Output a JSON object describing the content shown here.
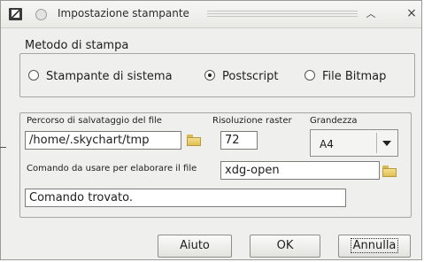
{
  "window": {
    "title": "Impostazione stampante"
  },
  "print_method": {
    "title": "Metodo di stampa",
    "options": [
      {
        "label": "Stampante di sistema",
        "selected": false
      },
      {
        "label": "Postscript",
        "selected": true
      },
      {
        "label": "File Bitmap",
        "selected": false
      }
    ]
  },
  "settings": {
    "save_path_label": "Percorso di salvataggio del file",
    "save_path_value": "/home/.skychart/tmp",
    "raster_label": "Risoluzione raster",
    "raster_value": "72",
    "size_label": "Grandezza",
    "size_value": "A4",
    "command_label": "Comando da usare per elaborare il file",
    "command_value": "xdg-open",
    "status_value": "Comando trovato."
  },
  "buttons": {
    "help": "Aiuto",
    "ok": "OK",
    "cancel": "Annulla"
  },
  "icons": [
    "app-icon",
    "window-menu-icon",
    "shade-icon",
    "close-icon",
    "folder-icon",
    "chevron-down-icon"
  ],
  "colors": {
    "window_bg": "#efefed",
    "field_bg": "#ffffff",
    "border": "#a5a5a2"
  }
}
